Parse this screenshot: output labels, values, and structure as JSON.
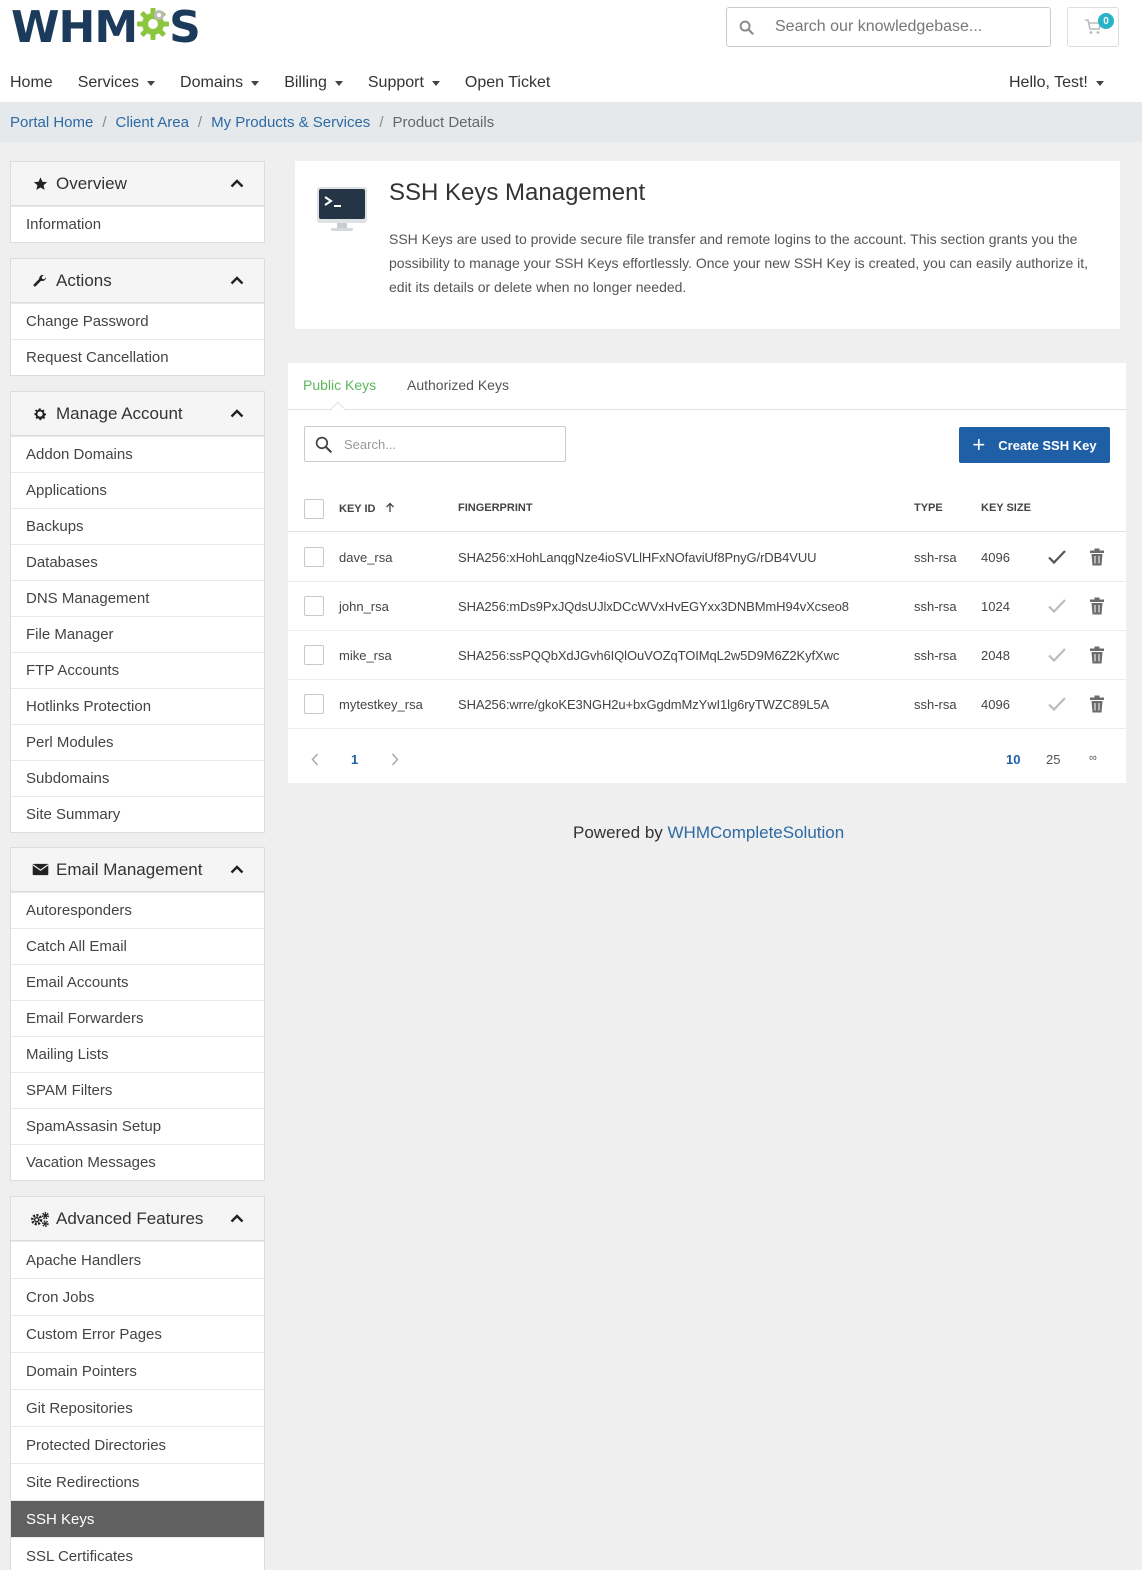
{
  "brand": {
    "logo_left": "WHM",
    "logo_right": "S"
  },
  "header": {
    "search_placeholder": "Search our knowledgebase...",
    "cart_count": "0",
    "nav": [
      {
        "label": "Home"
      },
      {
        "label": "Services"
      },
      {
        "label": "Domains"
      },
      {
        "label": "Billing"
      },
      {
        "label": "Support"
      },
      {
        "label": "Open Ticket"
      }
    ],
    "user_greeting": "Hello, Test!"
  },
  "breadcrumb": [
    "Portal Home",
    "Client Area",
    "My Products & Services",
    "Product Details"
  ],
  "sidebar": {
    "overview": {
      "title": "Overview",
      "items": [
        "Information"
      ]
    },
    "actions": {
      "title": "Actions",
      "items": [
        "Change Password",
        "Request Cancellation"
      ]
    },
    "manage_account": {
      "title": "Manage Account",
      "items": [
        "Addon Domains",
        "Applications",
        "Backups",
        "Databases",
        "DNS Management",
        "File Manager",
        "FTP Accounts",
        "Hotlinks Protection",
        "Perl Modules",
        "Subdomains",
        "Site Summary"
      ]
    },
    "email_management": {
      "title": "Email Management",
      "items": [
        "Autoresponders",
        "Catch All Email",
        "Email Accounts",
        "Email Forwarders",
        "Mailing Lists",
        "SPAM Filters",
        "SpamAssasin Setup",
        "Vacation Messages"
      ]
    },
    "advanced_features": {
      "title": "Advanced Features",
      "items": [
        "Apache Handlers",
        "Cron Jobs",
        "Custom Error Pages",
        "Domain Pointers",
        "Git Repositories",
        "Protected Directories",
        "Site Redirections",
        "SSH Keys",
        "SSL Certificates"
      ],
      "active": "SSH Keys"
    }
  },
  "intro": {
    "title": "SSH Keys Management",
    "description": "SSH Keys are used to provide secure file transfer and remote logins to the account. This section grants you the possibility to manage your SSH Keys effortlessly. Once your new SSH Key is created, you can easily authorize it, edit its details or delete when no longer needed."
  },
  "tabs": [
    {
      "label": "Public Keys",
      "active": true
    },
    {
      "label": "Authorized Keys",
      "active": false
    }
  ],
  "table": {
    "search_placeholder": "Search...",
    "create_label": "Create SSH Key",
    "columns": [
      "Key ID",
      "Fingerprint",
      "Type",
      "Key Size"
    ],
    "rows": [
      {
        "key_id": "dave_rsa",
        "fingerprint": "SHA256:xHohLanqgNze4ioSVLlHFxNOfaviUf8PnyG/rDB4VUU",
        "type": "ssh-rsa",
        "size": "4096",
        "authorized": true
      },
      {
        "key_id": "john_rsa",
        "fingerprint": "SHA256:mDs9PxJQdsUJlxDCcWVxHvEGYxx3DNBMmH94vXcseo8",
        "type": "ssh-rsa",
        "size": "1024",
        "authorized": false
      },
      {
        "key_id": "mike_rsa",
        "fingerprint": "SHA256:ssPQQbXdJGvh6IQlOuVOZqTOIMqL2w5D9M6Z2KyfXwc",
        "type": "ssh-rsa",
        "size": "2048",
        "authorized": false
      },
      {
        "key_id": "mytestkey_rsa",
        "fingerprint": "SHA256:wrre/gkoKE3NGH2u+bxGgdmMzYwI1lg6ryTWZC89L5A",
        "type": "ssh-rsa",
        "size": "4096",
        "authorized": false
      }
    ],
    "pager": {
      "current_page": "1",
      "page_sizes": [
        "10",
        "25",
        "∞"
      ],
      "active_size": "10"
    }
  },
  "footer": {
    "prefix": "Powered by",
    "link": "WHMCompleteSolution"
  },
  "colors": {
    "brand_navy": "#1b3a5c",
    "accent_green": "#5bb85d",
    "primary_blue": "#1f5fa6",
    "link_blue": "#2d6aa3",
    "active_item": "#606060"
  }
}
